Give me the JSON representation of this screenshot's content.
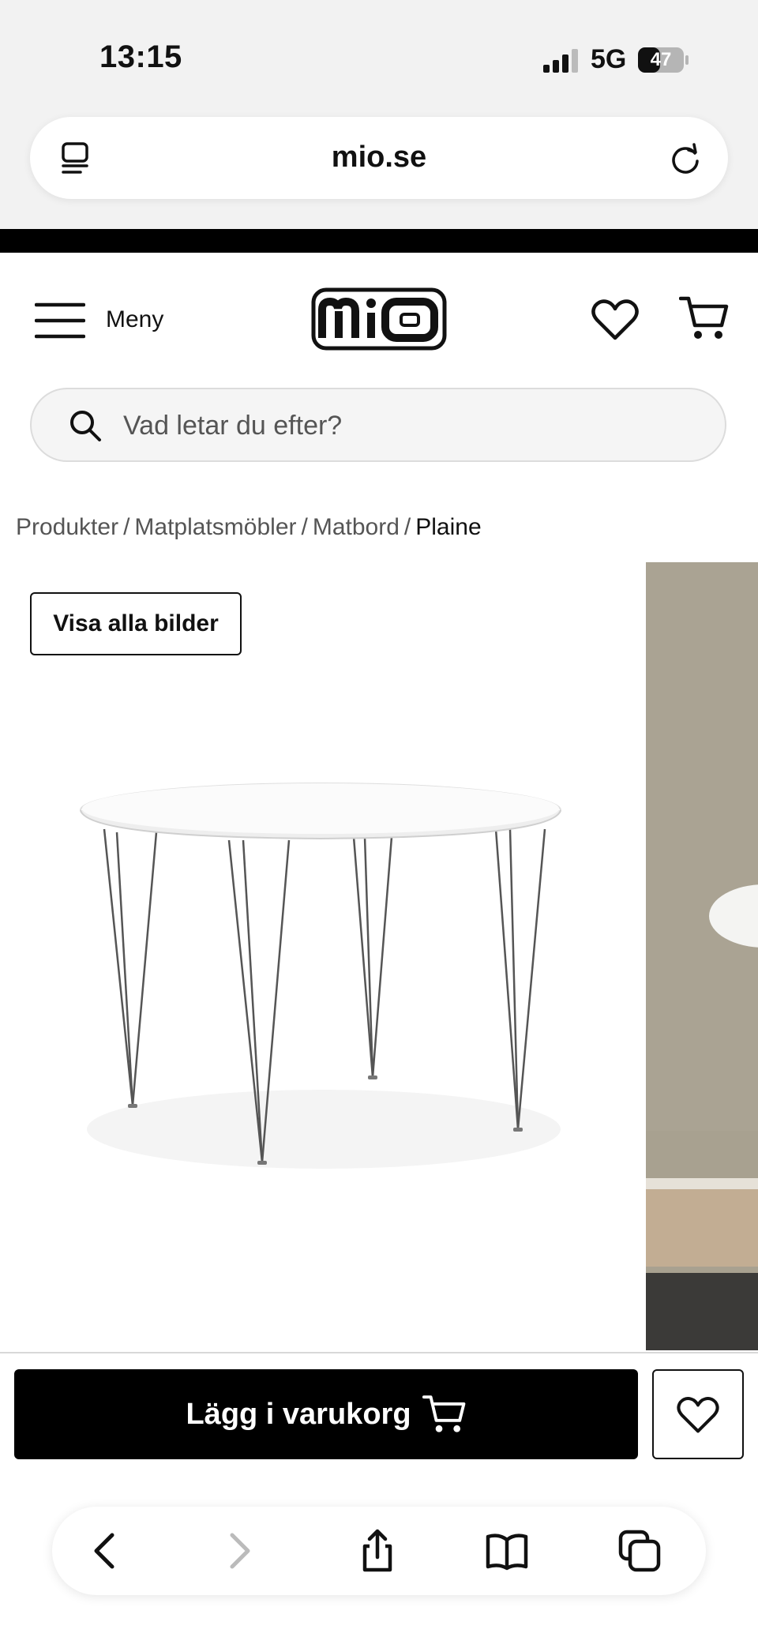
{
  "status_bar": {
    "time": "13:15",
    "network": "5G",
    "battery": "47"
  },
  "browser": {
    "url": "mio.se",
    "icons": {
      "tabs": "page-menu-icon",
      "reload": "reload-icon",
      "back": "chevron-left-icon",
      "forward": "chevron-right-icon",
      "share": "share-icon",
      "bookmarks": "book-icon",
      "tabs_overview": "tabs-icon"
    }
  },
  "header": {
    "menu_label": "Meny",
    "logo_text": "mio"
  },
  "search": {
    "placeholder": "Vad letar du efter?"
  },
  "breadcrumb": {
    "items": [
      "Produkter",
      "Matplatsmöbler",
      "Matbord"
    ],
    "current": "Plaine"
  },
  "gallery": {
    "view_all_label": "Visa alla bilder"
  },
  "buy_bar": {
    "add_to_cart_label": "Lägg i varukorg"
  },
  "colors": {
    "brand": "#000000",
    "background": "#ffffff",
    "search_bg": "#f5f5f5"
  }
}
